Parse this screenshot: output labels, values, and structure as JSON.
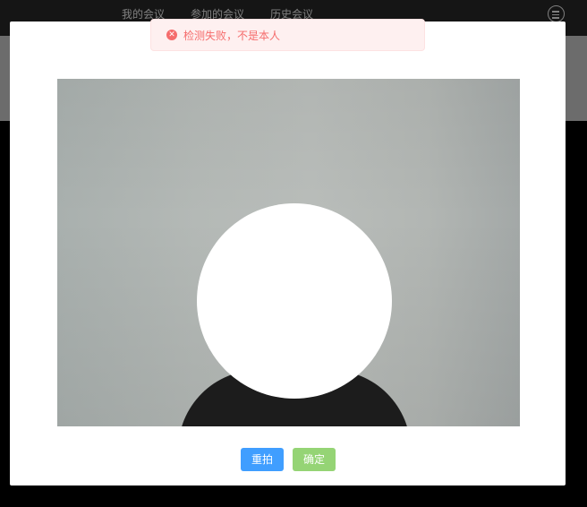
{
  "nav": {
    "items": [
      {
        "label": "我的会议"
      },
      {
        "label": "参加的会议"
      },
      {
        "label": "历史会议"
      }
    ],
    "menu_icon": "menu-circle-icon"
  },
  "toast": {
    "type": "error",
    "icon": "error-circle-icon",
    "message": "检测失败，不是本人",
    "color": "#f56c6c",
    "background": "#fef0f0"
  },
  "modal": {
    "camera_preview": {
      "face_mask": "face-mask-circle"
    },
    "buttons": {
      "retake_label": "重拍",
      "confirm_label": "确定",
      "retake_color": "#409eff",
      "confirm_color": "#95d475"
    }
  }
}
